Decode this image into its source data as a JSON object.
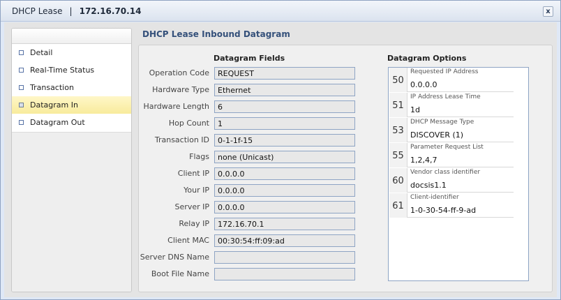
{
  "window": {
    "title": "DHCP Lease",
    "separator": "|",
    "ip": "172.16.70.14",
    "close_label": "x"
  },
  "sidebar": {
    "items": [
      {
        "label": "Detail"
      },
      {
        "label": "Real-Time Status"
      },
      {
        "label": "Transaction"
      },
      {
        "label": "Datagram In"
      },
      {
        "label": "Datagram Out"
      }
    ]
  },
  "main": {
    "section_title": "DHCP Lease Inbound Datagram",
    "fields_heading": "Datagram Fields",
    "options_heading": "Datagram Options",
    "fields": [
      {
        "label": "Operation Code",
        "value": "REQUEST"
      },
      {
        "label": "Hardware Type",
        "value": "Ethernet"
      },
      {
        "label": "Hardware Length",
        "value": "6"
      },
      {
        "label": "Hop Count",
        "value": "1"
      },
      {
        "label": "Transaction ID",
        "value": "0-1-1f-15"
      },
      {
        "label": "Flags",
        "value": "none (Unicast)"
      },
      {
        "label": "Client IP",
        "value": "0.0.0.0"
      },
      {
        "label": "Your IP",
        "value": "0.0.0.0"
      },
      {
        "label": "Server IP",
        "value": "0.0.0.0"
      },
      {
        "label": "Relay IP",
        "value": "172.16.70.1"
      },
      {
        "label": "Client MAC",
        "value": "00:30:54:ff:09:ad"
      },
      {
        "label": "Server DNS Name",
        "value": ""
      },
      {
        "label": "Boot File Name",
        "value": ""
      }
    ],
    "options": [
      {
        "code": "50",
        "name": "Requested IP Address",
        "value": "0.0.0.0"
      },
      {
        "code": "51",
        "name": "IP Address Lease Time",
        "value": "1d"
      },
      {
        "code": "53",
        "name": "DHCP Message Type",
        "value": "DISCOVER (1)"
      },
      {
        "code": "55",
        "name": "Parameter Request List",
        "value": "1,2,4,7"
      },
      {
        "code": "60",
        "name": "Vendor class identifier",
        "value": "docsis1.1"
      },
      {
        "code": "61",
        "name": "Client-identifier",
        "value": "1-0-30-54-ff-9-ad"
      }
    ]
  },
  "colors": {
    "accent": "#34507a",
    "active_nav": "#f8eb9c",
    "input_border": "#8ea4c4"
  }
}
